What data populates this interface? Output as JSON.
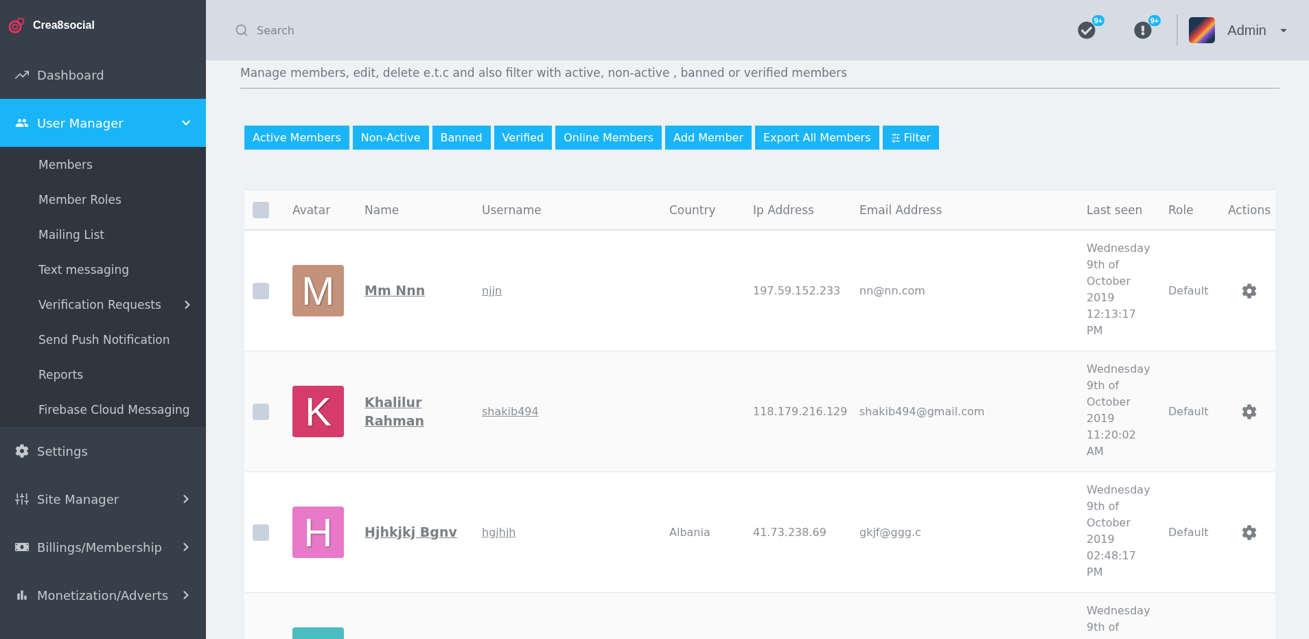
{
  "brand": "Crea8social",
  "sidebar": {
    "items": [
      {
        "label": "Dashboard",
        "selected": false
      },
      {
        "label": "User Manager",
        "selected": true,
        "expanded": true,
        "children": [
          {
            "label": "Members",
            "selected": false
          },
          {
            "label": "Member Roles",
            "selected": false
          },
          {
            "label": "Mailing List",
            "selected": false
          },
          {
            "label": "Text messaging",
            "selected": false
          },
          {
            "label": "Verification Requests",
            "selected": false,
            "expanded": false
          },
          {
            "label": "Send Push Notification",
            "selected": false
          },
          {
            "label": "Reports",
            "selected": false
          },
          {
            "label": "Firebase Cloud Messaging",
            "selected": false
          }
        ]
      },
      {
        "label": "Settings",
        "selected": false
      },
      {
        "label": "Site Manager",
        "selected": false,
        "expanded": false
      },
      {
        "label": "Billings/Membership",
        "selected": false,
        "expanded": false
      },
      {
        "label": "Monetization/Adverts",
        "selected": false,
        "expanded": false
      }
    ]
  },
  "topbar": {
    "search": {
      "placeholder": "Search"
    },
    "notifications": [
      {
        "kind": "tasks",
        "badge": "9+"
      },
      {
        "kind": "alerts",
        "badge": "9+"
      }
    ],
    "user": "Admin"
  },
  "subtitle": "Manage members, edit, delete e.t.c and also filter with active, non-active , banned or verified members",
  "filter_buttons": [
    {
      "label": "Active Members"
    },
    {
      "label": "Non-Active"
    },
    {
      "label": "Banned"
    },
    {
      "label": "Verified"
    },
    {
      "label": "Online Members"
    },
    {
      "label": "Add Member"
    },
    {
      "label": "Export All Members"
    },
    {
      "label": "Filter",
      "kind": "filter"
    }
  ],
  "table": {
    "select_all": {
      "checked": false
    },
    "columns": [
      "Avatar",
      "Name",
      "Username",
      "Country",
      "Ip Address",
      "Email Address",
      "Last seen",
      "Role",
      "Actions"
    ],
    "rows": [
      {
        "checked": false,
        "avatar": "M",
        "color": "#c4917a",
        "name": "Mm Nnn",
        "username": "njjn",
        "ip": "197.59.152.233",
        "email": "nn@nn.com",
        "last_seen": "Wednesday 9th of October 2019 12:13:17 PM",
        "role": "Default"
      },
      {
        "checked": false,
        "avatar": "K",
        "color": "#d63c6b",
        "name": "Khalilur Rahman",
        "username": "shakib494",
        "ip": "118.179.216.129",
        "email": "shakib494@gmail.com",
        "last_seen": "Wednesday 9th of October 2019 11:20:02 AM",
        "role": "Default"
      },
      {
        "checked": false,
        "avatar": "H",
        "color": "#e879c9",
        "name": "Hjhkjkj Bgnv",
        "username": "hgjhjh",
        "country": "Albania",
        "ip": "41.73.238.69",
        "email": "gkjf@ggg.c",
        "last_seen": "Wednesday 9th of October 2019 02:48:17 PM",
        "role": "Default"
      },
      {
        "color": "#4bbcc0",
        "last_seen": "Wednesday 9th of"
      }
    ]
  }
}
